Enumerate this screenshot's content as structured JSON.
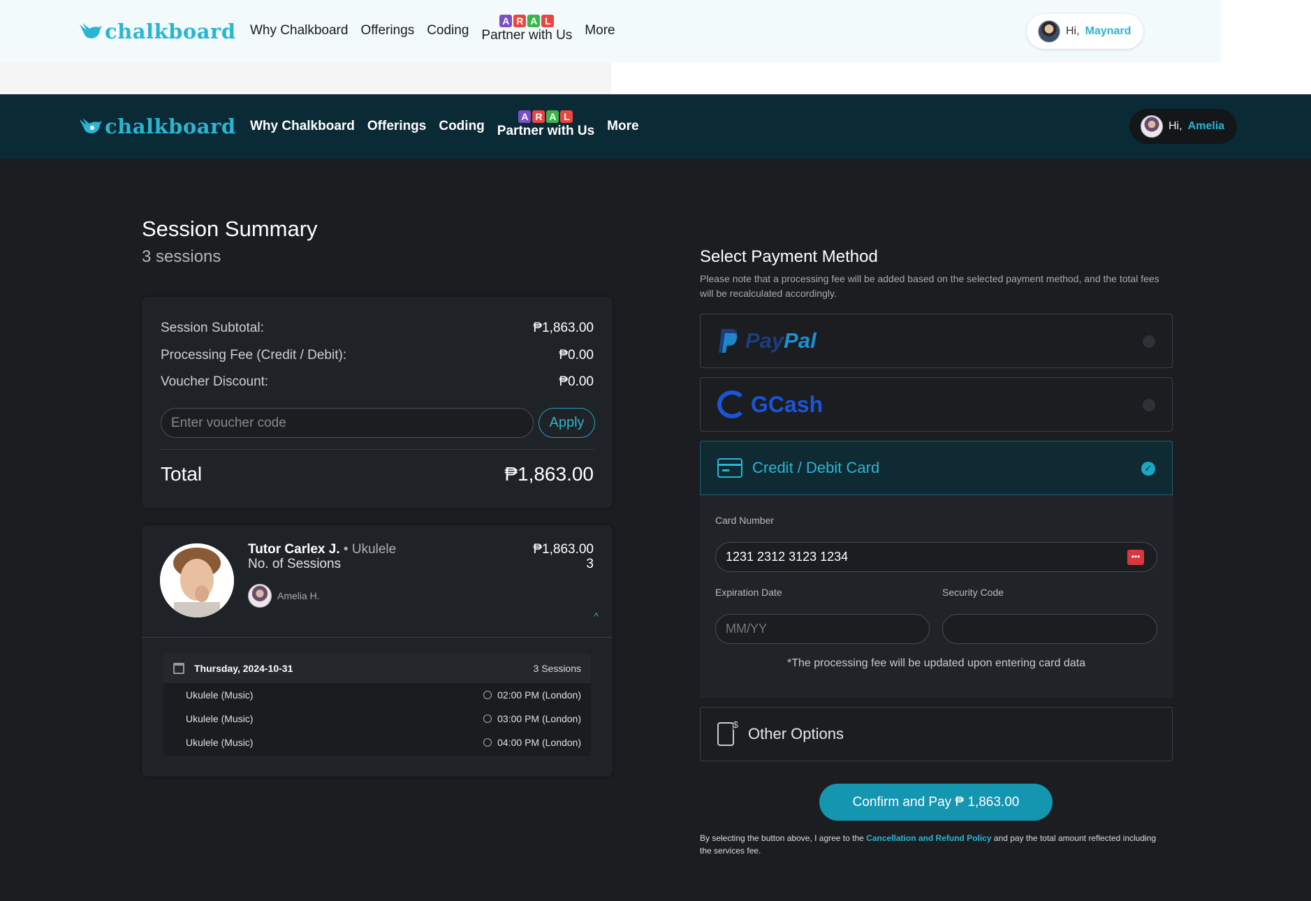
{
  "brand": {
    "logo_text": "chalkboard",
    "accent": "#29b6d2"
  },
  "nav": {
    "items": [
      "Why Chalkboard",
      "Offerings",
      "Coding"
    ],
    "aral_letters": [
      "A",
      "R",
      "A",
      "L"
    ],
    "partner": "Partner with Us",
    "more": "More"
  },
  "top_user": {
    "greeting": "Hi,",
    "name": "Maynard"
  },
  "dark_user": {
    "greeting": "Hi,",
    "name": "Amelia"
  },
  "session": {
    "title": "Session Summary",
    "count": "3 sessions"
  },
  "summary": {
    "subtotal_label": "Session Subtotal:",
    "subtotal": "₱1,863.00",
    "fee_label": "Processing Fee (Credit / Debit):",
    "fee": "₱0.00",
    "voucher_label": "Voucher Discount:",
    "voucher": "₱0.00",
    "voucher_placeholder": "Enter voucher code",
    "apply": "Apply",
    "total_label": "Total",
    "total": "₱1,863.00"
  },
  "tutor": {
    "name": "Tutor Carlex J.",
    "separator": "•",
    "subject": "Ukulele",
    "sessions_label": "No. of Sessions",
    "price": "₱1,863.00",
    "sessions": "3",
    "learner": "Amelia H.",
    "day": "Thursday, 2024-10-31",
    "day_count": "3 Sessions",
    "slots": [
      {
        "name": "Ukulele (Music)",
        "time": "02:00 PM (London)"
      },
      {
        "name": "Ukulele (Music)",
        "time": "03:00 PM (London)"
      },
      {
        "name": "Ukulele (Music)",
        "time": "04:00 PM (London)"
      }
    ]
  },
  "payment": {
    "title": "Select Payment Method",
    "note": "Please note that a processing fee will be added based on the selected payment method, and the total fees will be recalculated accordingly.",
    "paypal_pay": "Pay",
    "paypal_pal": "Pal",
    "gcash": "GCash",
    "card_label": "Credit / Debit Card",
    "card_number_label": "Card Number",
    "card_number": "1231 2312 3123 1234",
    "expiry_label": "Expiration Date",
    "expiry_placeholder": "MM/YY",
    "cvc_label": "Security Code",
    "cvc": "",
    "fee_note": "*The processing fee will be updated upon entering card data",
    "other": "Other Options",
    "confirm": "Confirm and Pay ₱ 1,863.00",
    "agree_pre": "By selecting the button above, I agree to the",
    "agree_link": "Cancellation and Refund Policy",
    "agree_post": "and pay the total amount reflected including the services fee."
  }
}
